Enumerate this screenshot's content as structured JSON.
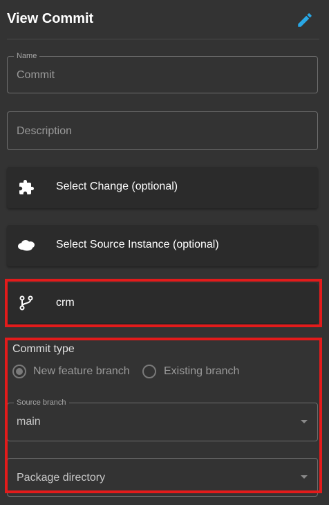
{
  "header": {
    "title": "View Commit"
  },
  "fields": {
    "name": {
      "label": "Name",
      "value": "Commit"
    },
    "description": {
      "placeholder": "Description"
    }
  },
  "selectors": {
    "change": {
      "label": "Select Change (optional)",
      "icon": "puzzle-icon"
    },
    "source_instance": {
      "label": "Select Source Instance (optional)",
      "icon": "cloud-icon"
    },
    "repository": {
      "label": "crm",
      "icon": "git-branch-icon"
    }
  },
  "commit_type": {
    "title": "Commit type",
    "options": [
      {
        "label": "New feature branch",
        "selected": true
      },
      {
        "label": "Existing branch",
        "selected": false
      }
    ]
  },
  "source_branch": {
    "label": "Source branch",
    "value": "main"
  },
  "package_directory": {
    "placeholder": "Package directory"
  },
  "colors": {
    "background": "#333333",
    "card": "#2b2b2b",
    "accent_edit": "#29a8e6",
    "highlight": "#e31b1b"
  }
}
